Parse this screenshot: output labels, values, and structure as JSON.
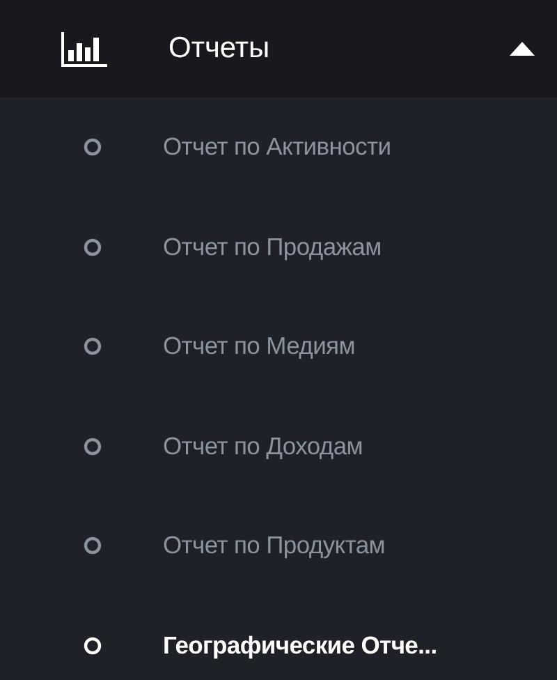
{
  "menu": {
    "title": "Отчеты",
    "expanded": true,
    "items": [
      {
        "label": "Отчет по Активности",
        "selected": false
      },
      {
        "label": "Отчет по Продажам",
        "selected": false
      },
      {
        "label": "Отчет по Медиям",
        "selected": false
      },
      {
        "label": "Отчет по Доходам",
        "selected": false
      },
      {
        "label": "Отчет по Продуктам",
        "selected": false
      },
      {
        "label": "Географические Отче...",
        "selected": true
      }
    ]
  }
}
